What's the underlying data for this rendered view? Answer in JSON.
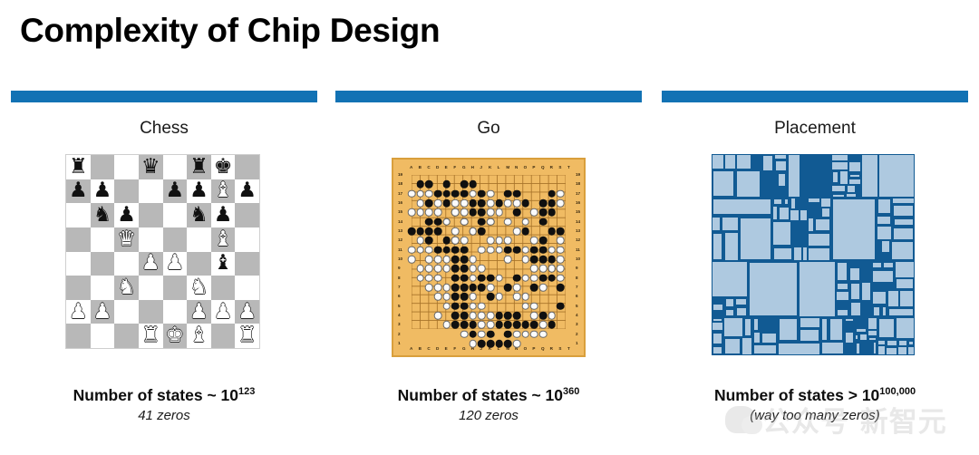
{
  "slide": {
    "title": "Complexity of Chip Design",
    "accent_color": "#1272b4"
  },
  "columns": [
    {
      "key": "chess",
      "title": "Chess",
      "caption_main": "Number of states ~ 10",
      "caption_exponent": "123",
      "caption_sub": "41 zeros",
      "figure": "chess-board"
    },
    {
      "key": "go",
      "title": "Go",
      "caption_main": "Number of states ~ 10",
      "caption_exponent": "360",
      "caption_sub": "120 zeros",
      "figure": "go-board"
    },
    {
      "key": "placement",
      "title": "Placement",
      "caption_main": "Number of states > 10",
      "caption_exponent": "100,000",
      "caption_sub": "(way too many zeros)",
      "figure": "chip-placement-diagram"
    }
  ],
  "chess": {
    "rows": [
      [
        "r",
        "",
        "",
        "q",
        "",
        "r",
        "k",
        ""
      ],
      [
        "p",
        "p",
        "",
        "",
        "p",
        "p",
        "B",
        "p"
      ],
      [
        "",
        "n",
        "p",
        "",
        "",
        "n",
        "p",
        ""
      ],
      [
        "",
        "",
        "Q",
        "",
        "",
        "",
        "B",
        ""
      ],
      [
        "",
        "",
        "",
        "P",
        "P",
        "",
        "b",
        ""
      ],
      [
        "",
        "",
        "N",
        "",
        "",
        "N",
        "",
        ""
      ],
      [
        "P",
        "P",
        "",
        "",
        "",
        "P",
        "P",
        "P"
      ],
      [
        "",
        "",
        "",
        "R",
        "K",
        "B",
        "",
        "R"
      ]
    ],
    "glyphs": {
      "k": "♚",
      "q": "♛",
      "r": "♜",
      "b": "♝",
      "n": "♞",
      "p": "♟",
      "K": "♚",
      "Q": "♛",
      "R": "♜",
      "B": "♝",
      "N": "♞",
      "P": "♟"
    },
    "light_square_color": "#ffffff",
    "dark_square_color": "#b8b8b8"
  },
  "go": {
    "board_color": "#f0bb63",
    "size": 19,
    "column_labels": [
      "A",
      "B",
      "C",
      "D",
      "E",
      "F",
      "G",
      "H",
      "J",
      "K",
      "L",
      "M",
      "N",
      "O",
      "P",
      "Q",
      "R",
      "S",
      "T"
    ],
    "row_labels": [
      "19",
      "18",
      "17",
      "16",
      "15",
      "14",
      "13",
      "12",
      "11",
      "10",
      "9",
      "8",
      "7",
      "6",
      "5",
      "4",
      "3",
      "2",
      "1"
    ],
    "black_stones": [
      [
        1,
        18
      ],
      [
        2,
        18
      ],
      [
        4,
        18
      ],
      [
        6,
        18
      ],
      [
        7,
        18
      ],
      [
        3,
        17
      ],
      [
        4,
        17
      ],
      [
        5,
        17
      ],
      [
        6,
        17
      ],
      [
        8,
        17
      ],
      [
        11,
        17
      ],
      [
        12,
        17
      ],
      [
        16,
        17
      ],
      [
        2,
        16
      ],
      [
        4,
        16
      ],
      [
        7,
        16
      ],
      [
        8,
        16
      ],
      [
        10,
        16
      ],
      [
        13,
        16
      ],
      [
        15,
        16
      ],
      [
        16,
        16
      ],
      [
        5,
        15
      ],
      [
        7,
        15
      ],
      [
        8,
        15
      ],
      [
        12,
        15
      ],
      [
        15,
        15
      ],
      [
        16,
        15
      ],
      [
        2,
        14
      ],
      [
        3,
        14
      ],
      [
        4,
        14
      ],
      [
        6,
        14
      ],
      [
        8,
        14
      ],
      [
        9,
        14
      ],
      [
        15,
        14
      ],
      [
        0,
        13
      ],
      [
        1,
        13
      ],
      [
        2,
        13
      ],
      [
        3,
        13
      ],
      [
        7,
        13
      ],
      [
        8,
        13
      ],
      [
        13,
        13
      ],
      [
        16,
        13
      ],
      [
        17,
        13
      ],
      [
        2,
        12
      ],
      [
        4,
        12
      ],
      [
        5,
        12
      ],
      [
        15,
        12
      ],
      [
        3,
        11
      ],
      [
        4,
        11
      ],
      [
        5,
        11
      ],
      [
        6,
        11
      ],
      [
        11,
        11
      ],
      [
        12,
        11
      ],
      [
        14,
        11
      ],
      [
        15,
        11
      ],
      [
        5,
        10
      ],
      [
        6,
        10
      ],
      [
        14,
        10
      ],
      [
        15,
        10
      ],
      [
        16,
        10
      ],
      [
        5,
        9
      ],
      [
        6,
        9
      ],
      [
        16,
        9
      ],
      [
        5,
        8
      ],
      [
        6,
        8
      ],
      [
        8,
        8
      ],
      [
        9,
        8
      ],
      [
        12,
        8
      ],
      [
        15,
        8
      ],
      [
        16,
        8
      ],
      [
        5,
        7
      ],
      [
        6,
        7
      ],
      [
        7,
        7
      ],
      [
        8,
        7
      ],
      [
        11,
        7
      ],
      [
        14,
        7
      ],
      [
        17,
        7
      ],
      [
        5,
        6
      ],
      [
        6,
        6
      ],
      [
        9,
        6
      ],
      [
        5,
        5
      ],
      [
        6,
        5
      ],
      [
        17,
        5
      ],
      [
        5,
        4
      ],
      [
        6,
        4
      ],
      [
        10,
        4
      ],
      [
        11,
        4
      ],
      [
        12,
        4
      ],
      [
        15,
        4
      ],
      [
        5,
        3
      ],
      [
        6,
        3
      ],
      [
        7,
        3
      ],
      [
        10,
        3
      ],
      [
        11,
        3
      ],
      [
        12,
        3
      ],
      [
        13,
        3
      ],
      [
        14,
        3
      ],
      [
        16,
        3
      ],
      [
        7,
        2
      ],
      [
        9,
        2
      ],
      [
        11,
        2
      ],
      [
        8,
        1
      ],
      [
        9,
        1
      ],
      [
        10,
        1
      ],
      [
        11,
        1
      ]
    ],
    "white_stones": [
      [
        0,
        17
      ],
      [
        1,
        17
      ],
      [
        2,
        17
      ],
      [
        7,
        17
      ],
      [
        9,
        17
      ],
      [
        17,
        17
      ],
      [
        1,
        16
      ],
      [
        3,
        16
      ],
      [
        5,
        16
      ],
      [
        6,
        16
      ],
      [
        9,
        16
      ],
      [
        11,
        16
      ],
      [
        12,
        16
      ],
      [
        17,
        16
      ],
      [
        0,
        15
      ],
      [
        1,
        15
      ],
      [
        2,
        15
      ],
      [
        3,
        15
      ],
      [
        5,
        15
      ],
      [
        6,
        15
      ],
      [
        9,
        15
      ],
      [
        10,
        15
      ],
      [
        14,
        15
      ],
      [
        4,
        14
      ],
      [
        6,
        14
      ],
      [
        9,
        14
      ],
      [
        11,
        14
      ],
      [
        13,
        14
      ],
      [
        5,
        13
      ],
      [
        7,
        13
      ],
      [
        12,
        13
      ],
      [
        1,
        12
      ],
      [
        5,
        12
      ],
      [
        6,
        12
      ],
      [
        9,
        12
      ],
      [
        10,
        12
      ],
      [
        11,
        12
      ],
      [
        14,
        12
      ],
      [
        17,
        12
      ],
      [
        0,
        11
      ],
      [
        1,
        11
      ],
      [
        2,
        11
      ],
      [
        8,
        11
      ],
      [
        9,
        11
      ],
      [
        10,
        11
      ],
      [
        13,
        11
      ],
      [
        16,
        11
      ],
      [
        17,
        11
      ],
      [
        0,
        10
      ],
      [
        2,
        10
      ],
      [
        3,
        10
      ],
      [
        4,
        10
      ],
      [
        7,
        10
      ],
      [
        11,
        10
      ],
      [
        13,
        10
      ],
      [
        17,
        10
      ],
      [
        1,
        9
      ],
      [
        2,
        9
      ],
      [
        3,
        9
      ],
      [
        4,
        9
      ],
      [
        7,
        9
      ],
      [
        8,
        9
      ],
      [
        14,
        9
      ],
      [
        15,
        9
      ],
      [
        16,
        9
      ],
      [
        17,
        9
      ],
      [
        1,
        8
      ],
      [
        2,
        8
      ],
      [
        3,
        8
      ],
      [
        7,
        8
      ],
      [
        10,
        8
      ],
      [
        13,
        8
      ],
      [
        14,
        8
      ],
      [
        17,
        8
      ],
      [
        2,
        7
      ],
      [
        3,
        7
      ],
      [
        4,
        7
      ],
      [
        9,
        7
      ],
      [
        12,
        7
      ],
      [
        15,
        7
      ],
      [
        3,
        6
      ],
      [
        4,
        6
      ],
      [
        7,
        6
      ],
      [
        10,
        6
      ],
      [
        12,
        6
      ],
      [
        13,
        6
      ],
      [
        4,
        5
      ],
      [
        7,
        5
      ],
      [
        8,
        5
      ],
      [
        13,
        5
      ],
      [
        14,
        5
      ],
      [
        3,
        4
      ],
      [
        7,
        4
      ],
      [
        8,
        4
      ],
      [
        9,
        4
      ],
      [
        14,
        4
      ],
      [
        16,
        4
      ],
      [
        4,
        3
      ],
      [
        8,
        3
      ],
      [
        9,
        3
      ],
      [
        15,
        3
      ],
      [
        6,
        2
      ],
      [
        8,
        2
      ],
      [
        12,
        2
      ],
      [
        13,
        2
      ],
      [
        14,
        2
      ],
      [
        15,
        2
      ],
      [
        7,
        1
      ],
      [
        12,
        1
      ]
    ]
  },
  "placement": {
    "background_color": "#115a93",
    "block_color": "#aec9e0",
    "description": "chip macro placement floorplan"
  },
  "watermark": {
    "text": "公众号 新智元",
    "logo": "wechat-logo"
  }
}
